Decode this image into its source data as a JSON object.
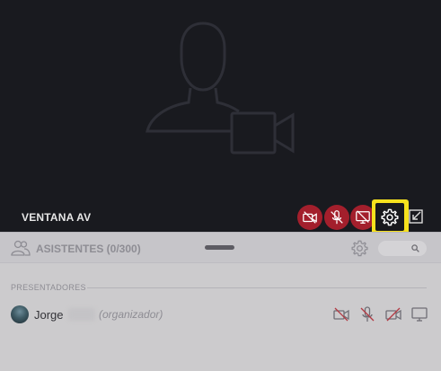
{
  "av_window": {
    "title": "VENTANA AV",
    "controls": [
      {
        "icon": "camera-off-icon",
        "state": "off"
      },
      {
        "icon": "microphone-off-icon",
        "state": "off"
      },
      {
        "icon": "screen-share-off-icon",
        "state": "off"
      },
      {
        "icon": "gear-icon",
        "state": "highlighted"
      },
      {
        "icon": "popout-icon",
        "state": "normal"
      }
    ],
    "colors": {
      "background": "#191a1f",
      "off_button": "#a31f2c",
      "highlight": "#f6e11d"
    }
  },
  "attendees": {
    "header_label": "ASISTENTES (0/300)",
    "search_icon": "search-icon",
    "section_label": "PRESENTADORES",
    "rows": [
      {
        "name": "Jorge",
        "role": "(organizador)",
        "status_icons": [
          "camera-off-icon",
          "microphone-off-icon",
          "video-off-icon",
          "screen-icon"
        ]
      }
    ]
  }
}
